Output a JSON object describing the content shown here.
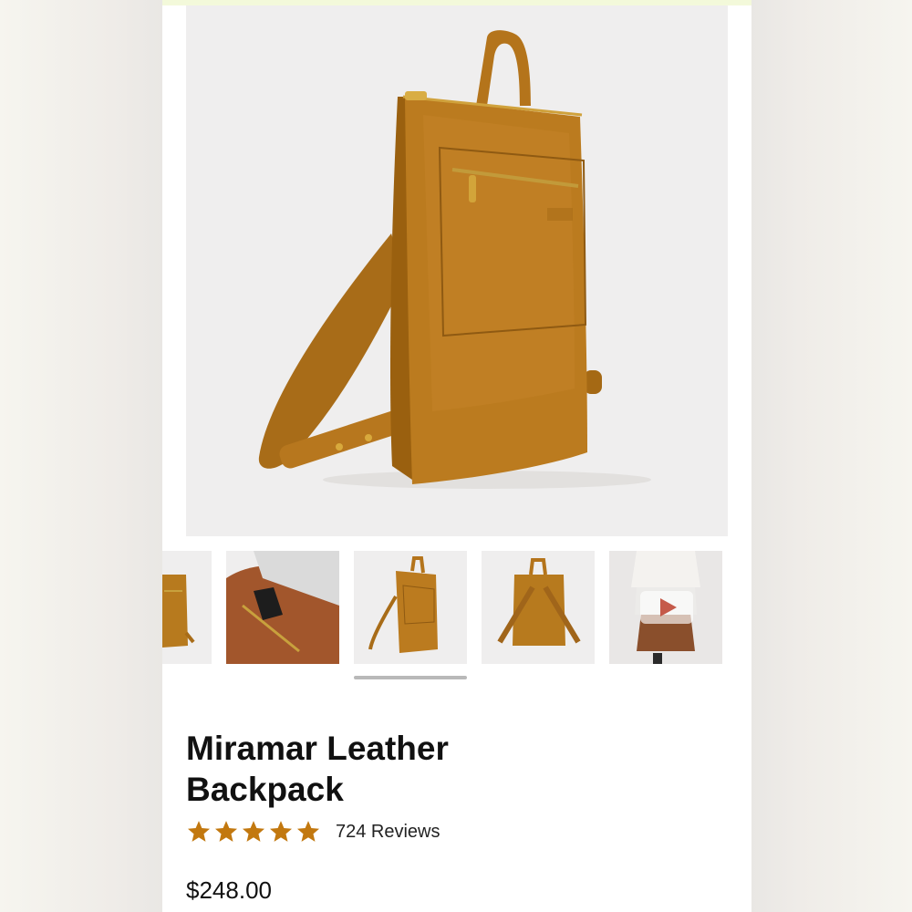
{
  "product": {
    "title": "Miramar Leather Backpack",
    "rating": 5,
    "rating_max": 5,
    "reviews_label": "724 Reviews",
    "price": "$248.00"
  },
  "colors": {
    "leather": "#b8781c",
    "leather_dark": "#8f5a12",
    "star": "#c2780f",
    "background": "#efeeee"
  },
  "thumbnails": [
    {
      "view": "front (partial)"
    },
    {
      "view": "interior pocket"
    },
    {
      "view": "side",
      "selected": true
    },
    {
      "view": "back straps"
    },
    {
      "view": "video",
      "icon": "play-icon"
    }
  ]
}
